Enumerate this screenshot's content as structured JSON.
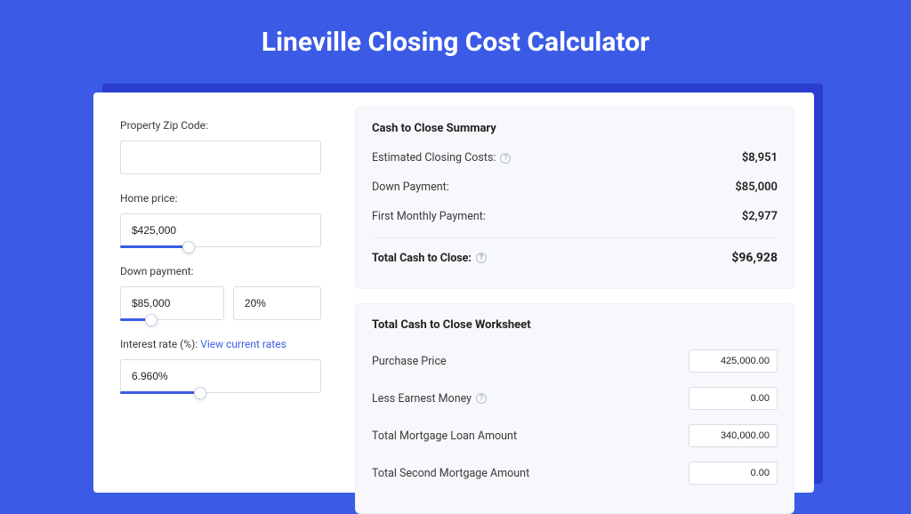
{
  "title": "Lineville Closing Cost Calculator",
  "left": {
    "zip_label": "Property Zip Code:",
    "zip_value": "",
    "home_price_label": "Home price:",
    "home_price_value": "$425,000",
    "down_payment_label": "Down payment:",
    "down_payment_value": "$85,000",
    "down_payment_pct": "20%",
    "interest_label": "Interest rate (%):",
    "interest_link": "View current rates",
    "interest_value": "6.960%"
  },
  "summary": {
    "title": "Cash to Close Summary",
    "rows": [
      {
        "label": "Estimated Closing Costs:",
        "value": "$8,951",
        "help": true
      },
      {
        "label": "Down Payment:",
        "value": "$85,000",
        "help": false
      },
      {
        "label": "First Monthly Payment:",
        "value": "$2,977",
        "help": false
      }
    ],
    "total_label": "Total Cash to Close:",
    "total_value": "$96,928"
  },
  "worksheet": {
    "title": "Total Cash to Close Worksheet",
    "rows": [
      {
        "label": "Purchase Price",
        "value": "425,000.00",
        "help": false
      },
      {
        "label": "Less Earnest Money",
        "value": "0.00",
        "help": true
      },
      {
        "label": "Total Mortgage Loan Amount",
        "value": "340,000.00",
        "help": false
      },
      {
        "label": "Total Second Mortgage Amount",
        "value": "0.00",
        "help": false
      }
    ]
  },
  "sliders": {
    "home_price_pct": 34,
    "down_payment_pct": 30,
    "interest_pct": 40
  }
}
